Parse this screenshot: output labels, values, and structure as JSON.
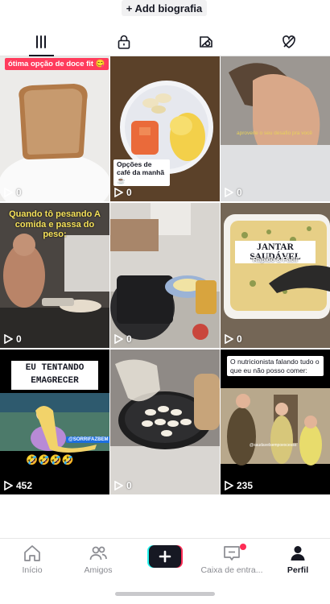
{
  "header": {
    "add_bio_label": "+ Add biografia"
  },
  "tabs": [
    {
      "name": "videos",
      "icon": "grid-icon",
      "active": true
    },
    {
      "name": "private",
      "icon": "lock-icon",
      "active": false
    },
    {
      "name": "reposts",
      "icon": "eye-off-icon",
      "active": false
    },
    {
      "name": "liked",
      "icon": "heart-off-icon",
      "active": false
    }
  ],
  "videos": [
    {
      "views": "0",
      "caption": "ótima opção de doce fit 😋"
    },
    {
      "views": "0",
      "caption": "Opções de café da manhã ☕️"
    },
    {
      "views": "0",
      "caption": "aproveite o seu desafio  pra você"
    },
    {
      "views": "0",
      "caption": "Quando tô pesando A comida e passa do peso:"
    },
    {
      "views": "0",
      "caption": ""
    },
    {
      "views": "0",
      "caption": "JANTAR SAUDÁVEL",
      "subcaption": "Rapido & Fácil"
    },
    {
      "views": "452",
      "caption": "EU TENTANDO EMAGRECER",
      "subcaption": "@SORRIFAZBEM",
      "emojis": "🤣🤣🤣🤣"
    },
    {
      "views": "0",
      "caption": ""
    },
    {
      "views": "235",
      "caption": "O nutricionista falando tudo o que eu não posso comer:",
      "subcaption": "@saudavelsempoexcesso"
    }
  ],
  "nav": [
    {
      "label": "Início",
      "icon": "home-icon"
    },
    {
      "label": "Amigos",
      "icon": "friends-icon"
    },
    {
      "label": "",
      "icon": "create-plus-icon"
    },
    {
      "label": "Caixa de entra...",
      "icon": "inbox-icon",
      "badge": true
    },
    {
      "label": "Perfil",
      "icon": "profile-icon",
      "active": true
    }
  ]
}
